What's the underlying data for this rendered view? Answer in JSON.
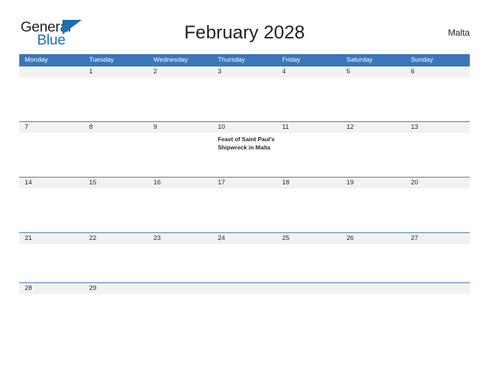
{
  "brand": {
    "name_part1": "General",
    "name_part2": "Blue",
    "triangle_icon": "blue-triangle-icon",
    "color_dark": "#231f20",
    "color_blue": "#1a6fb5"
  },
  "header": {
    "title": "February 2028",
    "locale": "Malta"
  },
  "theme": {
    "header_blue": "#3a77b8",
    "band_gray": "#f2f2f2",
    "text_dark": "#231f20",
    "page_bg": "#ffffff"
  },
  "calendar": {
    "month": "February",
    "year": "2028",
    "weekday_headers": [
      "Monday",
      "Tuesday",
      "Wednesday",
      "Thursday",
      "Friday",
      "Saturday",
      "Sunday"
    ],
    "weeks": [
      {
        "days": [
          {
            "date": "",
            "event": ""
          },
          {
            "date": "1",
            "event": ""
          },
          {
            "date": "2",
            "event": ""
          },
          {
            "date": "3",
            "event": ""
          },
          {
            "date": "4",
            "event": ""
          },
          {
            "date": "5",
            "event": ""
          },
          {
            "date": "6",
            "event": ""
          }
        ]
      },
      {
        "days": [
          {
            "date": "7",
            "event": ""
          },
          {
            "date": "8",
            "event": ""
          },
          {
            "date": "9",
            "event": ""
          },
          {
            "date": "10",
            "event": "Feast of Saint Paul's Shipwreck in Malta"
          },
          {
            "date": "11",
            "event": ""
          },
          {
            "date": "12",
            "event": ""
          },
          {
            "date": "13",
            "event": ""
          }
        ]
      },
      {
        "days": [
          {
            "date": "14",
            "event": ""
          },
          {
            "date": "15",
            "event": ""
          },
          {
            "date": "16",
            "event": ""
          },
          {
            "date": "17",
            "event": ""
          },
          {
            "date": "18",
            "event": ""
          },
          {
            "date": "19",
            "event": ""
          },
          {
            "date": "20",
            "event": ""
          }
        ]
      },
      {
        "days": [
          {
            "date": "21",
            "event": ""
          },
          {
            "date": "22",
            "event": ""
          },
          {
            "date": "23",
            "event": ""
          },
          {
            "date": "24",
            "event": ""
          },
          {
            "date": "25",
            "event": ""
          },
          {
            "date": "26",
            "event": ""
          },
          {
            "date": "27",
            "event": ""
          }
        ]
      },
      {
        "days": [
          {
            "date": "28",
            "event": ""
          },
          {
            "date": "29",
            "event": ""
          },
          {
            "date": "",
            "event": ""
          },
          {
            "date": "",
            "event": ""
          },
          {
            "date": "",
            "event": ""
          },
          {
            "date": "",
            "event": ""
          },
          {
            "date": "",
            "event": ""
          }
        ]
      }
    ]
  }
}
